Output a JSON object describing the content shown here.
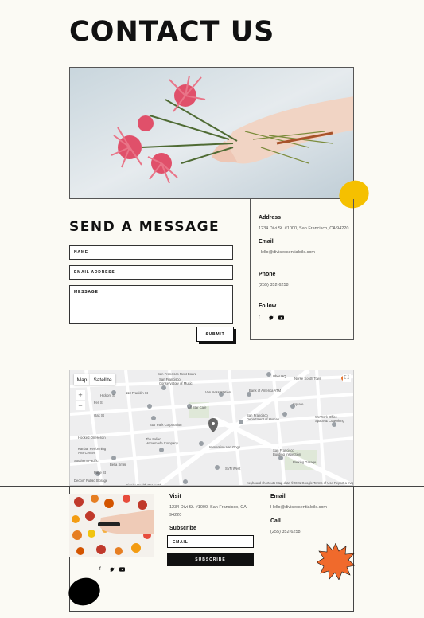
{
  "page": {
    "title": "CONTACT US"
  },
  "form": {
    "title": "SEND A MESSAGE",
    "name_placeholder": "NAME",
    "email_placeholder": "EMAIL ADDRESS",
    "message_placeholder": "MESSAGE",
    "submit_label": "SUBMIT"
  },
  "info": {
    "address_label": "Address",
    "address": "1234 Divi St. #1000, San Francisco, CA 94220",
    "email_label": "Email",
    "email": "Hello@divisessentialoils.com",
    "phone_label": "Phone",
    "phone": "(255) 352-6258",
    "follow_label": "Follow",
    "social_icons": [
      "facebook-icon",
      "twitter-icon",
      "youtube-icon"
    ]
  },
  "map": {
    "map_tab": "Map",
    "satellite_tab": "Satellite",
    "zoom_in": "+",
    "zoom_out": "−",
    "footer_text": "Keyboard shortcuts   Map data ©2021 Google   Terms of Use   Report a map error",
    "labels": [
      "San Francisco Conservatory of Music",
      "Van Ness Station",
      "Bank of America ATM",
      "Uber HQ",
      "Civic Center",
      "Star Park Corporation",
      "The Italian Homemade Company",
      "Immersion Van Gogh",
      "San Francisco Department of Human",
      "San Francisco Building Inspection",
      "Parking Garage",
      "Fell St",
      "Oak St",
      "Page St",
      "Haight St",
      "Van Ness Ave",
      "Market St",
      "Hickory St",
      "Bella Smile",
      "Decoin' Public Storage",
      "Dignity Health GoHealth",
      "Kanbar Performing Arts Center",
      "Hooked On Heroin",
      "Southern Pacific",
      "Square",
      "WeWork Office Space & Coworking",
      "Norse South Town",
      "SVN West"
    ]
  },
  "footer": {
    "visit_label": "Visit",
    "visit_address": "1234 Divi St. #1000, San Francisco, CA 94220",
    "email_label": "Email",
    "email": "Hello@divisessentialoils.com",
    "call_label": "Call",
    "phone": "(255) 352-6258",
    "subscribe_label": "Subscribe",
    "subscribe_placeholder": "EMAIL",
    "subscribe_button": "SUBSCRIBE",
    "social_icons": [
      "facebook-icon",
      "twitter-icon",
      "youtube-icon"
    ]
  },
  "colors": {
    "accent_yellow": "#f5c000",
    "accent_orange": "#f06a2c",
    "background": "#fbfaf4"
  }
}
